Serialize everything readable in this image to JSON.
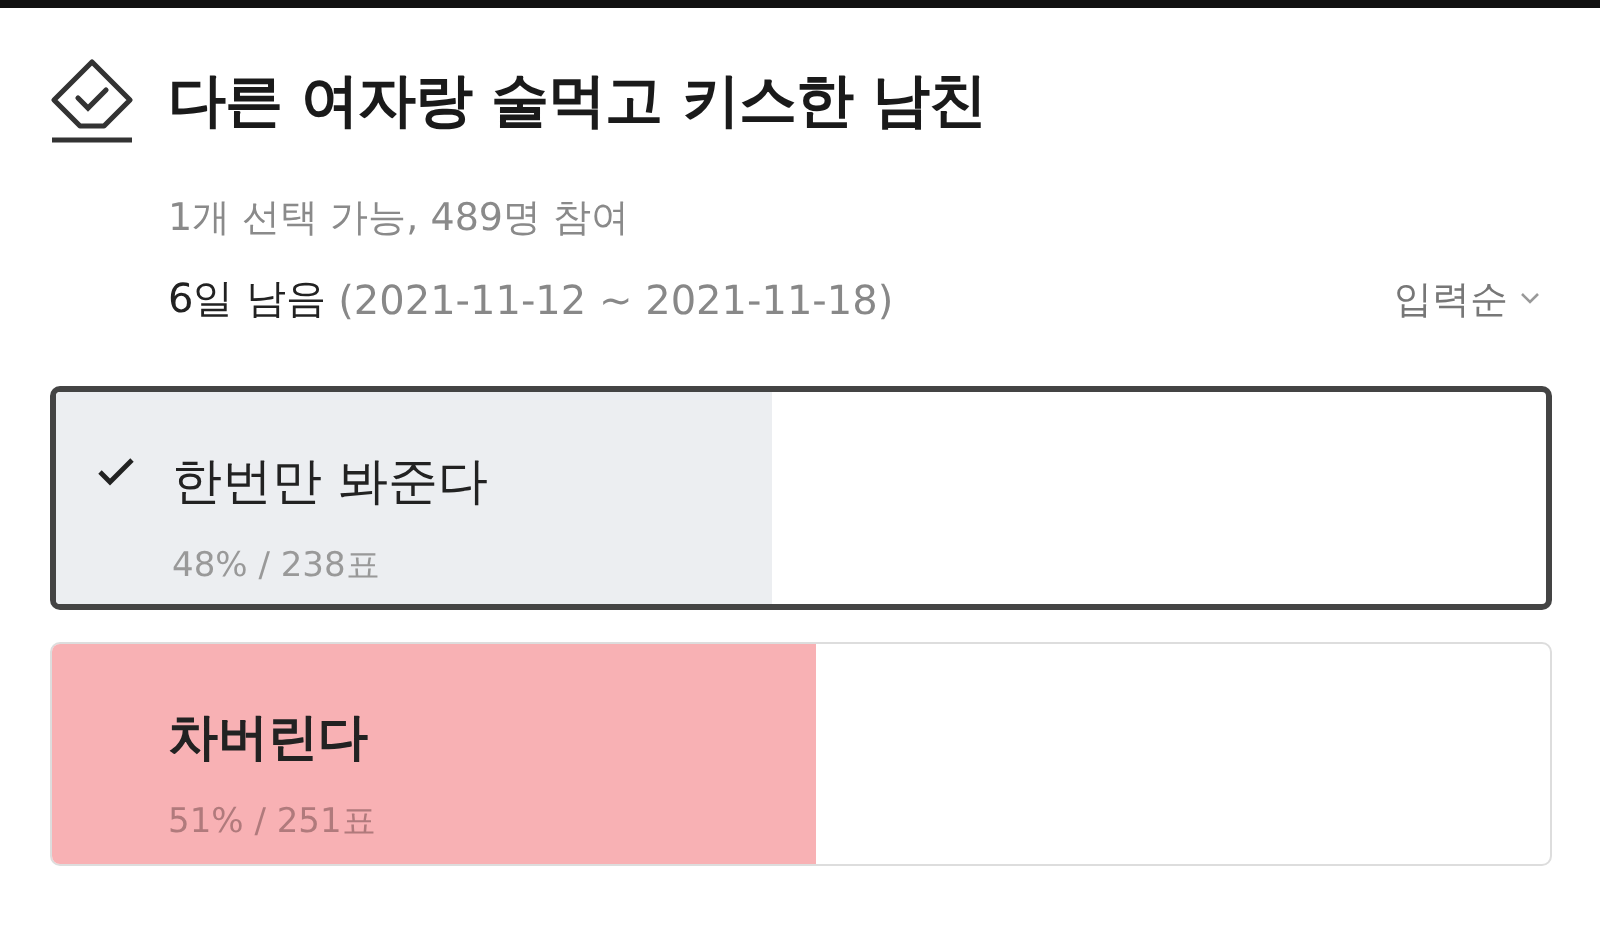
{
  "poll": {
    "title": "다른 여자랑 술먹고 키스한 남친",
    "meta": "1개 선택 가능, 489명 참여",
    "remaining": "6일 남음",
    "period": "(2021-11-12 ~ 2021-11-18)",
    "sort": "입력순",
    "options": [
      {
        "label": "한번만 봐준다",
        "result": "48% / 238표",
        "level": 0.48,
        "checked": true,
        "leading": false
      },
      {
        "label": "차버린다",
        "result": "51% / 251표",
        "level": 0.51,
        "checked": false,
        "leading": true
      }
    ]
  }
}
